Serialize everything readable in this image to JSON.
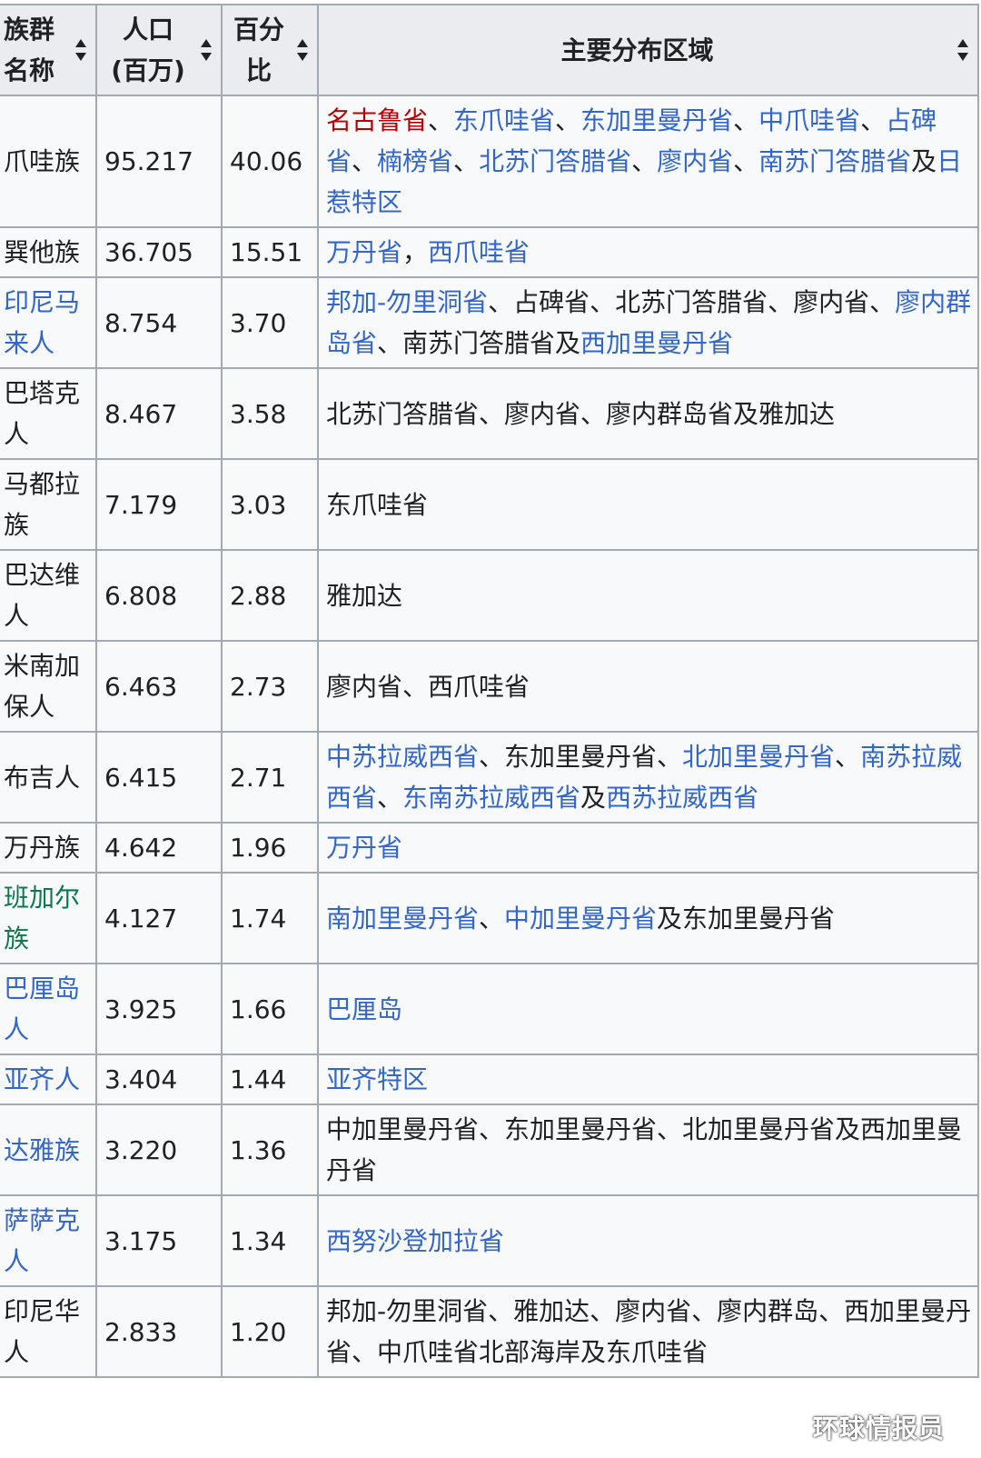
{
  "headers": [
    "族群名称",
    "人口(百万)",
    "百分比",
    "主要分布区域"
  ],
  "rows": [
    {
      "name": {
        "text": "爪哇族",
        "link": false
      },
      "pop": "95.217",
      "pct": "40.06",
      "regions": [
        {
          "t": "名古鲁省",
          "l": "red"
        },
        {
          "t": "、"
        },
        {
          "t": "东爪哇省",
          "l": "blue"
        },
        {
          "t": "、"
        },
        {
          "t": "东加里曼丹省",
          "l": "blue"
        },
        {
          "t": "、"
        },
        {
          "t": "中爪哇省",
          "l": "blue"
        },
        {
          "t": "、"
        },
        {
          "t": "占碑省",
          "l": "blue"
        },
        {
          "t": "、"
        },
        {
          "t": "楠榜省",
          "l": "blue"
        },
        {
          "t": "、"
        },
        {
          "t": "北苏门答腊省",
          "l": "blue"
        },
        {
          "t": "、"
        },
        {
          "t": "廖内省",
          "l": "blue"
        },
        {
          "t": "、"
        },
        {
          "t": "南苏门答腊省",
          "l": "blue"
        },
        {
          "t": "及"
        },
        {
          "t": "日惹特区",
          "l": "blue"
        }
      ]
    },
    {
      "name": {
        "text": "巽他族",
        "link": false
      },
      "pop": "36.705",
      "pct": "15.51",
      "regions": [
        {
          "t": "万丹省",
          "l": "blue"
        },
        {
          "t": "，"
        },
        {
          "t": "西爪哇省",
          "l": "blue"
        }
      ]
    },
    {
      "name": {
        "text": "印尼马来人",
        "link": "blue"
      },
      "pop": "8.754",
      "pct": "3.70",
      "regions": [
        {
          "t": "邦加-勿里洞省",
          "l": "blue"
        },
        {
          "t": "、占碑省、北苏门答腊省、廖内省、"
        },
        {
          "t": "廖内群岛省",
          "l": "blue"
        },
        {
          "t": "、南苏门答腊省及"
        },
        {
          "t": "西加里曼丹省",
          "l": "blue"
        }
      ]
    },
    {
      "name": {
        "text": "巴塔克人",
        "link": false
      },
      "pop": "8.467",
      "pct": "3.58",
      "regions": [
        {
          "t": "北苏门答腊省、廖内省、廖内群岛省及雅加达"
        }
      ]
    },
    {
      "name": {
        "text": "马都拉族",
        "link": false
      },
      "pop": "7.179",
      "pct": "3.03",
      "regions": [
        {
          "t": "东爪哇省"
        }
      ]
    },
    {
      "name": {
        "text": "巴达维人",
        "link": false
      },
      "pop": "6.808",
      "pct": "2.88",
      "regions": [
        {
          "t": "雅加达"
        }
      ]
    },
    {
      "name": {
        "text": "米南加保人",
        "link": false
      },
      "pop": "6.463",
      "pct": "2.73",
      "regions": [
        {
          "t": "廖内省、西爪哇省"
        }
      ]
    },
    {
      "name": {
        "text": "布吉人",
        "link": false
      },
      "pop": "6.415",
      "pct": "2.71",
      "regions": [
        {
          "t": "中苏拉威西省",
          "l": "blue"
        },
        {
          "t": "、东加里曼丹省、"
        },
        {
          "t": "北加里曼丹省",
          "l": "blue"
        },
        {
          "t": "、"
        },
        {
          "t": "南苏拉威西省",
          "l": "blue"
        },
        {
          "t": "、"
        },
        {
          "t": "东南苏拉威西省",
          "l": "blue"
        },
        {
          "t": "及"
        },
        {
          "t": "西苏拉威西省",
          "l": "blue"
        }
      ]
    },
    {
      "name": {
        "text": "万丹族",
        "link": false
      },
      "pop": "4.642",
      "pct": "1.96",
      "regions": [
        {
          "t": "万丹省",
          "l": "blue"
        }
      ]
    },
    {
      "name": {
        "text": "班加尔族",
        "link": "green"
      },
      "pop": "4.127",
      "pct": "1.74",
      "regions": [
        {
          "t": "南加里曼丹省",
          "l": "blue"
        },
        {
          "t": "、"
        },
        {
          "t": "中加里曼丹省",
          "l": "blue"
        },
        {
          "t": "及东加里曼丹省"
        }
      ]
    },
    {
      "name": {
        "text": "巴厘岛人",
        "link": "blue"
      },
      "pop": "3.925",
      "pct": "1.66",
      "regions": [
        {
          "t": "巴厘岛",
          "l": "blue"
        }
      ]
    },
    {
      "name": {
        "text": "亚齐人",
        "link": "blue"
      },
      "pop": "3.404",
      "pct": "1.44",
      "regions": [
        {
          "t": "亚齐特区",
          "l": "blue"
        }
      ]
    },
    {
      "name": {
        "text": "达雅族",
        "link": "blue"
      },
      "pop": "3.220",
      "pct": "1.36",
      "regions": [
        {
          "t": "中加里曼丹省、东加里曼丹省、北加里曼丹省及西加里曼丹省"
        }
      ]
    },
    {
      "name": {
        "text": "萨萨克人",
        "link": "blue"
      },
      "pop": "3.175",
      "pct": "1.34",
      "regions": [
        {
          "t": "西努沙登加拉省",
          "l": "blue"
        }
      ]
    },
    {
      "name": {
        "text": "印尼华人",
        "link": false
      },
      "pop": "2.833",
      "pct": "1.20",
      "regions": [
        {
          "t": "邦加-勿里洞省、雅加达、廖内省、廖内群岛、西加里曼丹省、中爪哇省北部海岸及东爪哇省"
        }
      ]
    }
  ],
  "watermark": "环球情报员",
  "colors": {
    "link": "#3366cc",
    "redlink": "#ba0000",
    "greenlink": "#0b7a4b",
    "header_bg": "#eaecf0",
    "cell_bg": "#f8f9fa",
    "border": "#a2a9b1"
  }
}
